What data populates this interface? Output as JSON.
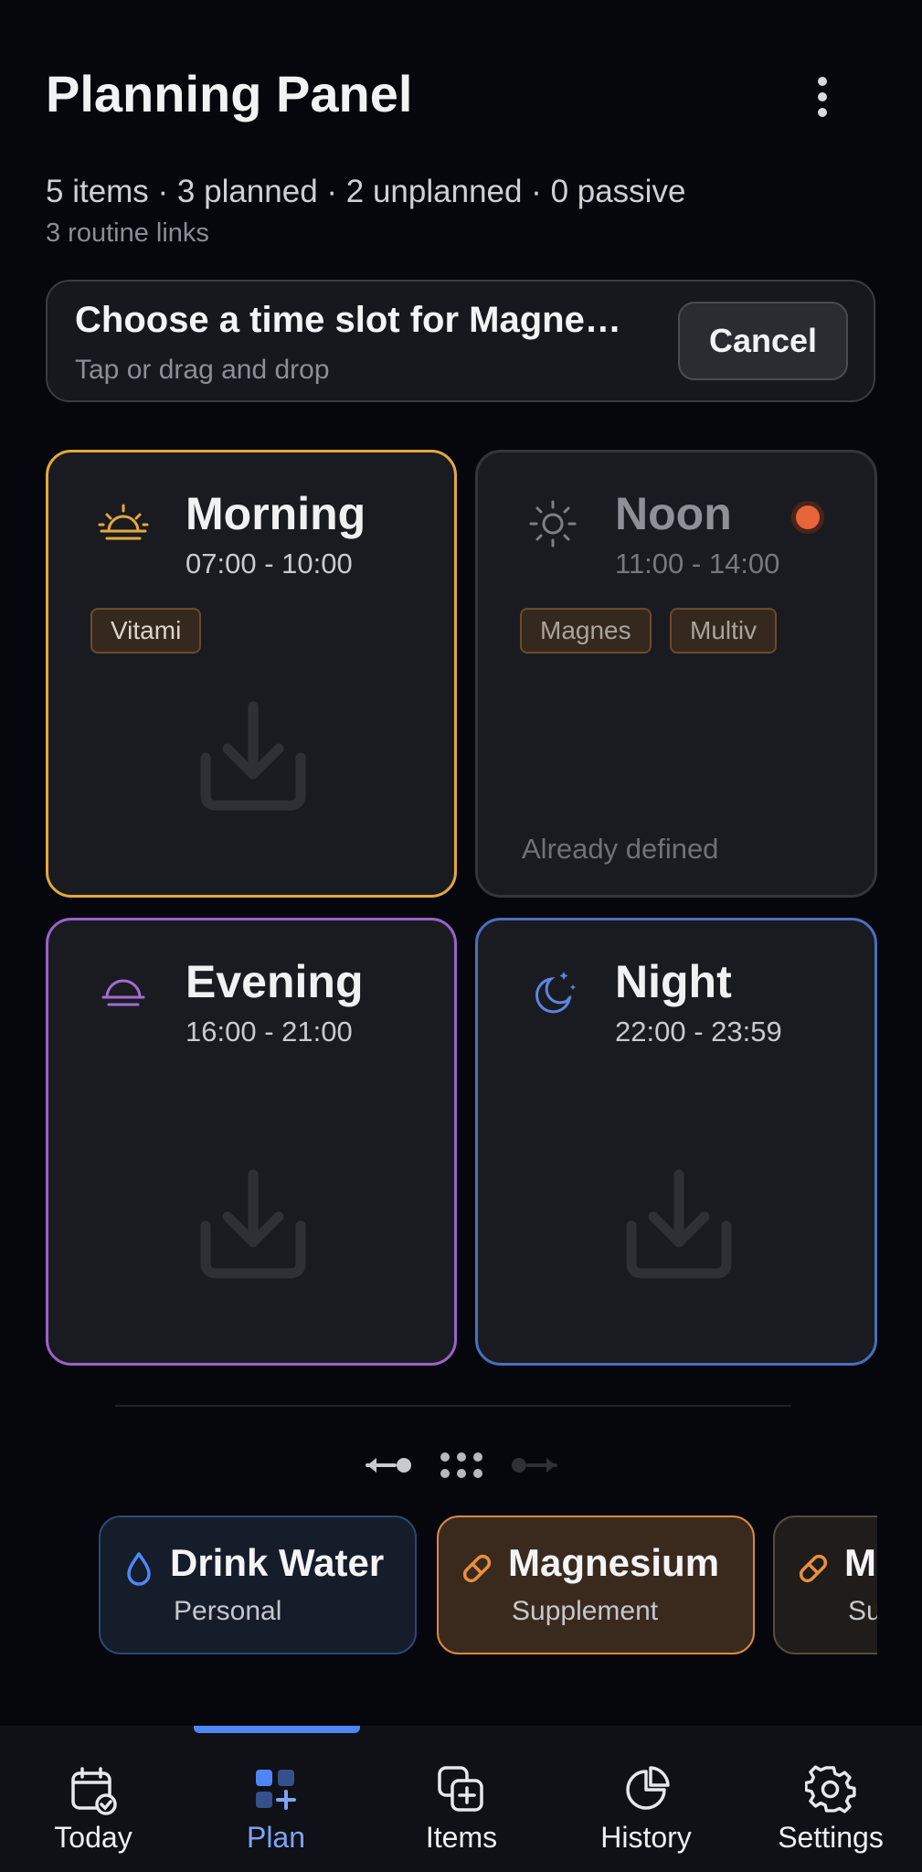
{
  "header": {
    "title": "Planning Panel"
  },
  "summary": {
    "stats": "5 items · 3 planned · 2 unplanned · 0 passive",
    "links": "3 routine links"
  },
  "banner": {
    "title": "Choose a time slot for Magne…",
    "subtitle": "Tap or drag and drop",
    "cancel_label": "Cancel"
  },
  "slots": [
    {
      "name": "Morning",
      "time": "07:00 - 10:00",
      "chips": [
        "Vitami"
      ],
      "accent": "#e2a93c",
      "icon": "sunrise-icon"
    },
    {
      "name": "Noon",
      "time": "11:00 - 14:00",
      "chips": [
        "Magnes",
        "Multiv"
      ],
      "status": "Already defined",
      "accent": "#33353b",
      "icon": "sun-icon"
    },
    {
      "name": "Evening",
      "time": "16:00 - 21:00",
      "chips": [],
      "accent": "#9a62c9",
      "icon": "sunset-icon"
    },
    {
      "name": "Night",
      "time": "22:00 - 23:59",
      "chips": [],
      "accent": "#4a6fc0",
      "icon": "moon-stars-icon"
    }
  ],
  "items": [
    {
      "name": "Drink Water",
      "category": "Personal",
      "icon": "droplet-icon",
      "accent": "#2d4773"
    },
    {
      "name": "Magnesium",
      "category": "Supplement",
      "icon": "pill-icon",
      "accent": "#d98a3f"
    },
    {
      "name": "M",
      "category": "Su",
      "icon": "pill-icon",
      "accent": "#5a4a3a"
    }
  ],
  "nav": {
    "today": "Today",
    "plan": "Plan",
    "items": "Items",
    "history": "History",
    "settings": "Settings",
    "active": "Plan"
  },
  "colors": {
    "accent_blue": "#4f86f7",
    "alert": "#e8643a"
  }
}
